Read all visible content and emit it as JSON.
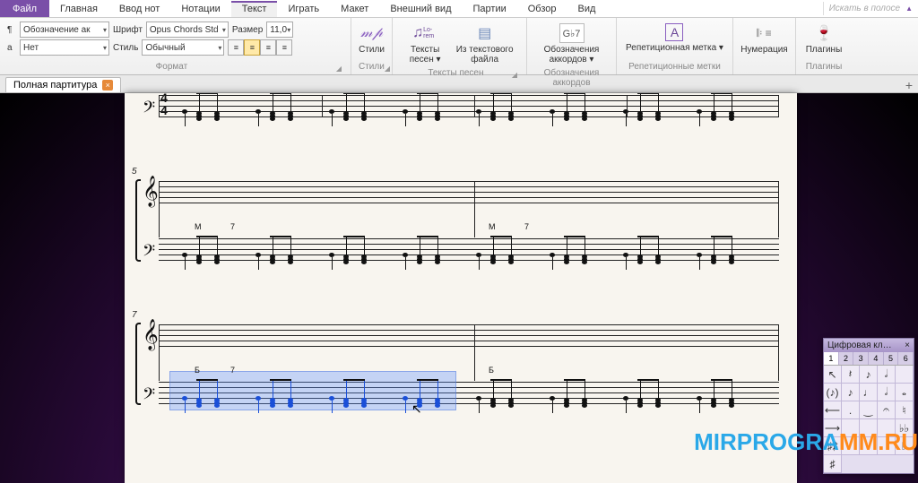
{
  "menu": {
    "file": "Файл",
    "items": [
      "Главная",
      "Ввод нот",
      "Нотации",
      "Текст",
      "Играть",
      "Макет",
      "Внешний вид",
      "Партии",
      "Обзор",
      "Вид"
    ],
    "active_index": 3,
    "search_placeholder": "Искать в полосе"
  },
  "ribbon": {
    "format": {
      "row1_prefix": "¶",
      "object_combo": "Обозначение ак",
      "font_label": "Шрифт",
      "font_value": "Opus Chords Std",
      "size_label": "Размер",
      "size_value": "11,0",
      "row2_prefix": "a",
      "net_combo": "Нет",
      "style_label": "Стиль",
      "style_value": "Обычный",
      "group_label": "Формат"
    },
    "groups": [
      {
        "icon": "𝓂𝓅",
        "label": "Стили",
        "sub": "Стили"
      },
      {
        "icon": "♫",
        "label": "Тексты песен ▾",
        "sub": ""
      },
      {
        "icon": "▤",
        "label": "Из текстового файла",
        "sub": "Тексты песен"
      },
      {
        "icon": "G♭7",
        "label": "Обозначения аккордов ▾",
        "sub": "Обозначения аккордов"
      },
      {
        "icon": "A",
        "label": "Репетиционная метка ▾",
        "sub": "Репетиционные метки"
      },
      {
        "icon": "≡",
        "label": "Нумерация",
        "sub": ""
      },
      {
        "icon": "▼",
        "label": "Плагины",
        "sub": "Плагины"
      }
    ]
  },
  "tab": {
    "title": "Полная партитура"
  },
  "score": {
    "time_sig_top": "4",
    "time_sig_bot": "4",
    "meas_5": "5",
    "meas_7": "7",
    "chord_marks": [
      "М",
      "7",
      "М",
      "7",
      "Б",
      "7",
      "Б"
    ]
  },
  "keypad": {
    "title": "Цифровая кл…",
    "tabs": [
      "1",
      "2",
      "3",
      "4",
      "5",
      "6"
    ],
    "cells": [
      "↖",
      "𝄽",
      "♪",
      "𝅗𝅥",
      "",
      "(♪)",
      "♪",
      "♩",
      "𝅗𝅥",
      "𝅝",
      "⟵",
      ".",
      "‿",
      "𝄐",
      "♮",
      "⟶",
      "",
      "",
      "",
      "♭♭",
      "♯♯",
      "",
      "",
      "",
      "♭",
      "♯"
    ]
  },
  "watermark_a": "MIRPROGRA",
  "watermark_b": "MM.RU"
}
